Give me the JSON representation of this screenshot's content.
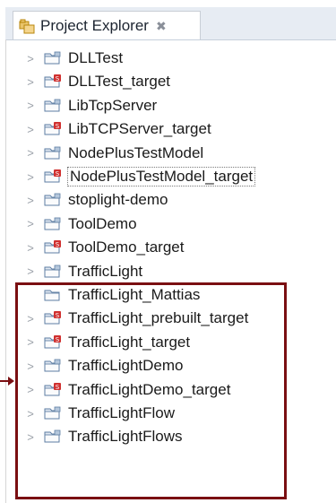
{
  "view": {
    "tab_title": "Project Explorer",
    "tab_close_glyph": "✖",
    "tab_icon": "project-explorer-icon"
  },
  "tree": {
    "items": [
      {
        "label": "DLLTest",
        "expander": ">",
        "icon": "folder-project-icon",
        "selected": false
      },
      {
        "label": "DLLTest_target",
        "expander": ">",
        "icon": "folder-target-icon",
        "selected": false
      },
      {
        "label": "LibTcpServer",
        "expander": ">",
        "icon": "folder-project-icon",
        "selected": false
      },
      {
        "label": "LibTCPServer_target",
        "expander": ">",
        "icon": "folder-target-icon",
        "selected": false
      },
      {
        "label": "NodePlusTestModel",
        "expander": ">",
        "icon": "folder-project-icon",
        "selected": false
      },
      {
        "label": "NodePlusTestModel_target",
        "expander": ">",
        "icon": "folder-target-icon",
        "selected": true
      },
      {
        "label": "stoplight-demo",
        "expander": ">",
        "icon": "folder-project-icon",
        "selected": false
      },
      {
        "label": "ToolDemo",
        "expander": ">",
        "icon": "folder-project-icon",
        "selected": false
      },
      {
        "label": "ToolDemo_target",
        "expander": ">",
        "icon": "folder-target-icon",
        "selected": false
      },
      {
        "label": "TrafficLight",
        "expander": ">",
        "icon": "folder-project-icon",
        "selected": false
      },
      {
        "label": "TrafficLight_Mattias",
        "expander": "",
        "icon": "folder-closed-icon",
        "selected": false
      },
      {
        "label": "TrafficLight_prebuilt_target",
        "expander": ">",
        "icon": "folder-target-icon",
        "selected": false
      },
      {
        "label": "TrafficLight_target",
        "expander": ">",
        "icon": "folder-target-icon",
        "selected": false
      },
      {
        "label": "TrafficLightDemo",
        "expander": ">",
        "icon": "folder-project-icon",
        "selected": false
      },
      {
        "label": "TrafficLightDemo_target",
        "expander": ">",
        "icon": "folder-target-icon",
        "selected": false
      },
      {
        "label": "TrafficLightFlow",
        "expander": ">",
        "icon": "folder-project-icon",
        "selected": false
      },
      {
        "label": "TrafficLightFlows",
        "expander": ">",
        "icon": "folder-project-icon",
        "selected": false
      }
    ]
  },
  "colors": {
    "highlight_border": "#7a0f12",
    "folder_fill": "#dfe7f1",
    "folder_stroke": "#5e7ea3",
    "target_badge": "#d0302f"
  }
}
